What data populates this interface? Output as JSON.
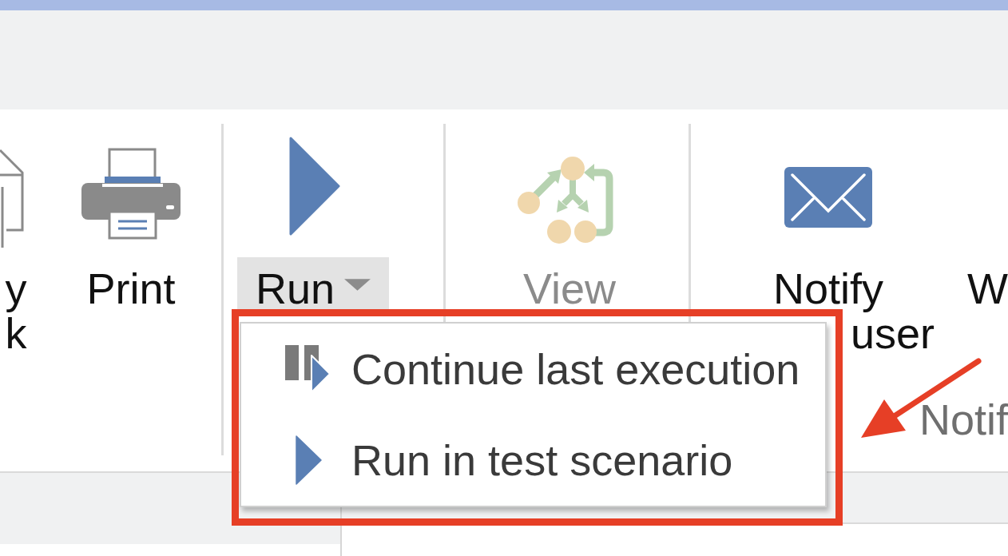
{
  "ribbon": {
    "groups": [
      {
        "buttons": [
          {
            "kind": "document",
            "label_lines": [
              "y",
              "k"
            ],
            "disabled": false
          },
          {
            "kind": "printer",
            "label_lines": [
              "Print"
            ],
            "disabled": false
          }
        ]
      },
      {
        "buttons": [
          {
            "kind": "play",
            "label_lines": [
              "Run"
            ],
            "disabled": false,
            "expanded": true
          }
        ]
      },
      {
        "buttons": [
          {
            "kind": "workflow",
            "label_lines": [
              "View"
            ],
            "disabled": true
          }
        ]
      },
      {
        "buttons": [
          {
            "kind": "mail",
            "label_lines": [
              "Notify",
              "user"
            ],
            "disabled": false
          },
          {
            "kind": "blank",
            "label_lines": [
              "W"
            ],
            "disabled": false
          }
        ],
        "label": "Notif"
      }
    ]
  },
  "dropdown_menu": {
    "items": [
      {
        "kind": "resume",
        "label": "Continue last execution"
      },
      {
        "kind": "play",
        "label": "Run in test scenario"
      }
    ]
  }
}
